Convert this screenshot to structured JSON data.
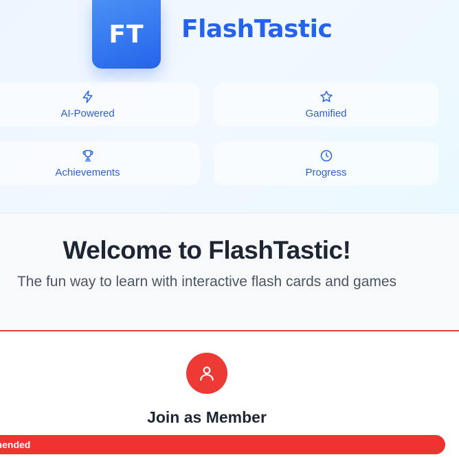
{
  "logo": {
    "initials": "FT"
  },
  "brand": {
    "name": "FlashTastic"
  },
  "features": [
    {
      "label": "AI-Powered",
      "icon": "lightning-icon"
    },
    {
      "label": "Gamified",
      "icon": "star-icon"
    },
    {
      "label": "Achievements",
      "icon": "trophy-icon"
    },
    {
      "label": "Progress",
      "icon": "clock-icon"
    }
  ],
  "welcome": {
    "title": "Welcome to FlashTastic!",
    "subtitle": "The fun way to learn with interactive flash cards and games"
  },
  "member_card": {
    "icon": "user-icon",
    "title": "Join as Member",
    "badge": "Recommended"
  },
  "colors": {
    "primary": "#2563eb",
    "accent_red": "#ee3330",
    "heading": "#1f2633"
  }
}
